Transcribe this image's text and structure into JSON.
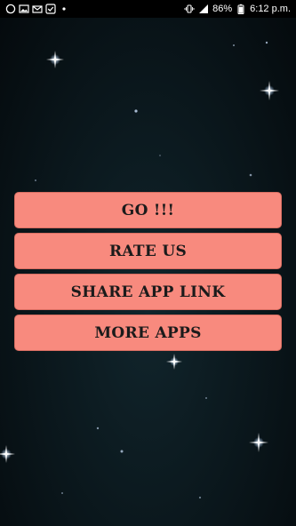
{
  "status_bar": {
    "battery": "86%",
    "time": "6:12 p.m.",
    "icons_left": [
      "whatsapp-icon",
      "gallery-icon",
      "mail-icon",
      "check-icon",
      "dot-icon"
    ],
    "icons_right": [
      "vibrate-icon",
      "signal-icon",
      "battery-icon"
    ]
  },
  "menu": {
    "buttons": [
      {
        "label": "GO !!!"
      },
      {
        "label": "RATE US"
      },
      {
        "label": "SHARE APP LINK"
      },
      {
        "label": "MORE APPS"
      }
    ]
  },
  "colors": {
    "button_bg": "#f88a7e",
    "background": "#0a161b"
  }
}
